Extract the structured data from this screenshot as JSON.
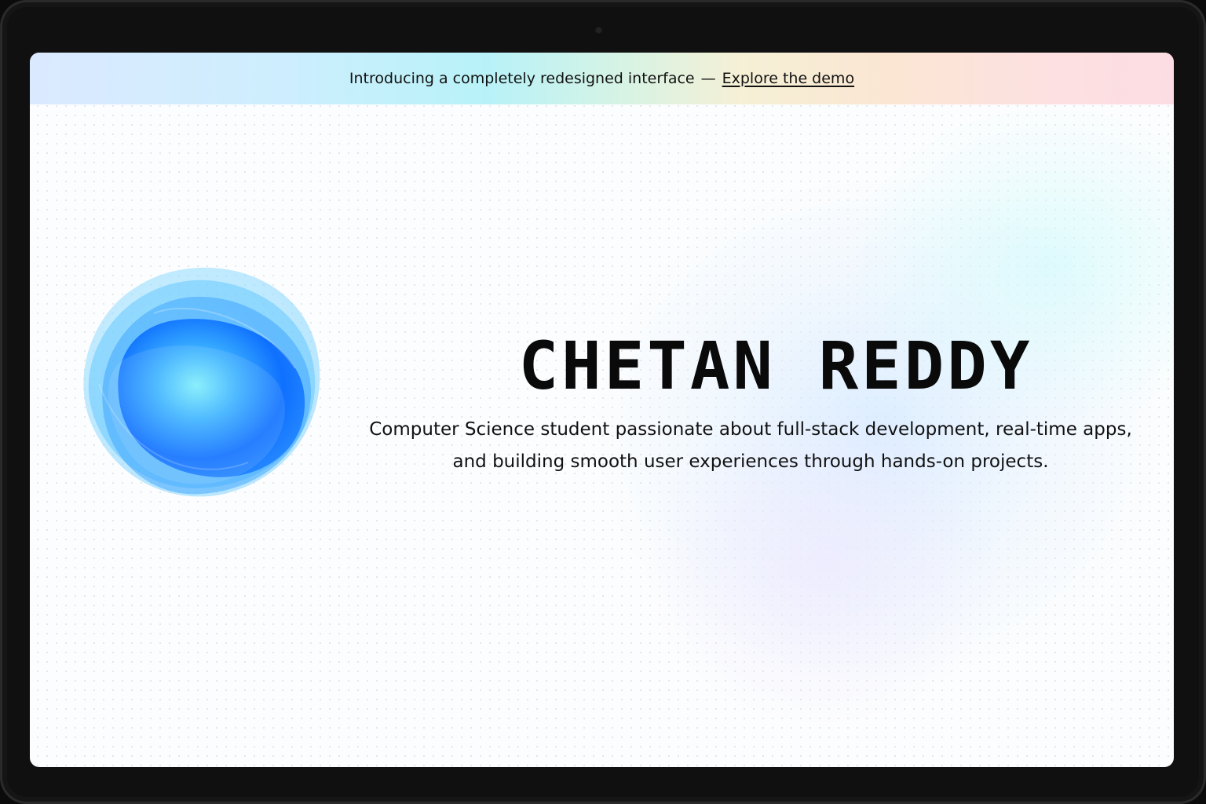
{
  "banner": {
    "message": "Introducing a completely redesigned interface",
    "separator": "—",
    "link_label": "Explore the demo"
  },
  "hero": {
    "name": "CHETAN REDDY",
    "tagline_line1": "Computer Science student passionate about full-stack development, real-time apps,",
    "tagline_line2": "and building smooth user experiences through hands-on projects."
  },
  "colors": {
    "accent_blue": "#0066ff",
    "accent_cyan": "#7ff0fb"
  }
}
